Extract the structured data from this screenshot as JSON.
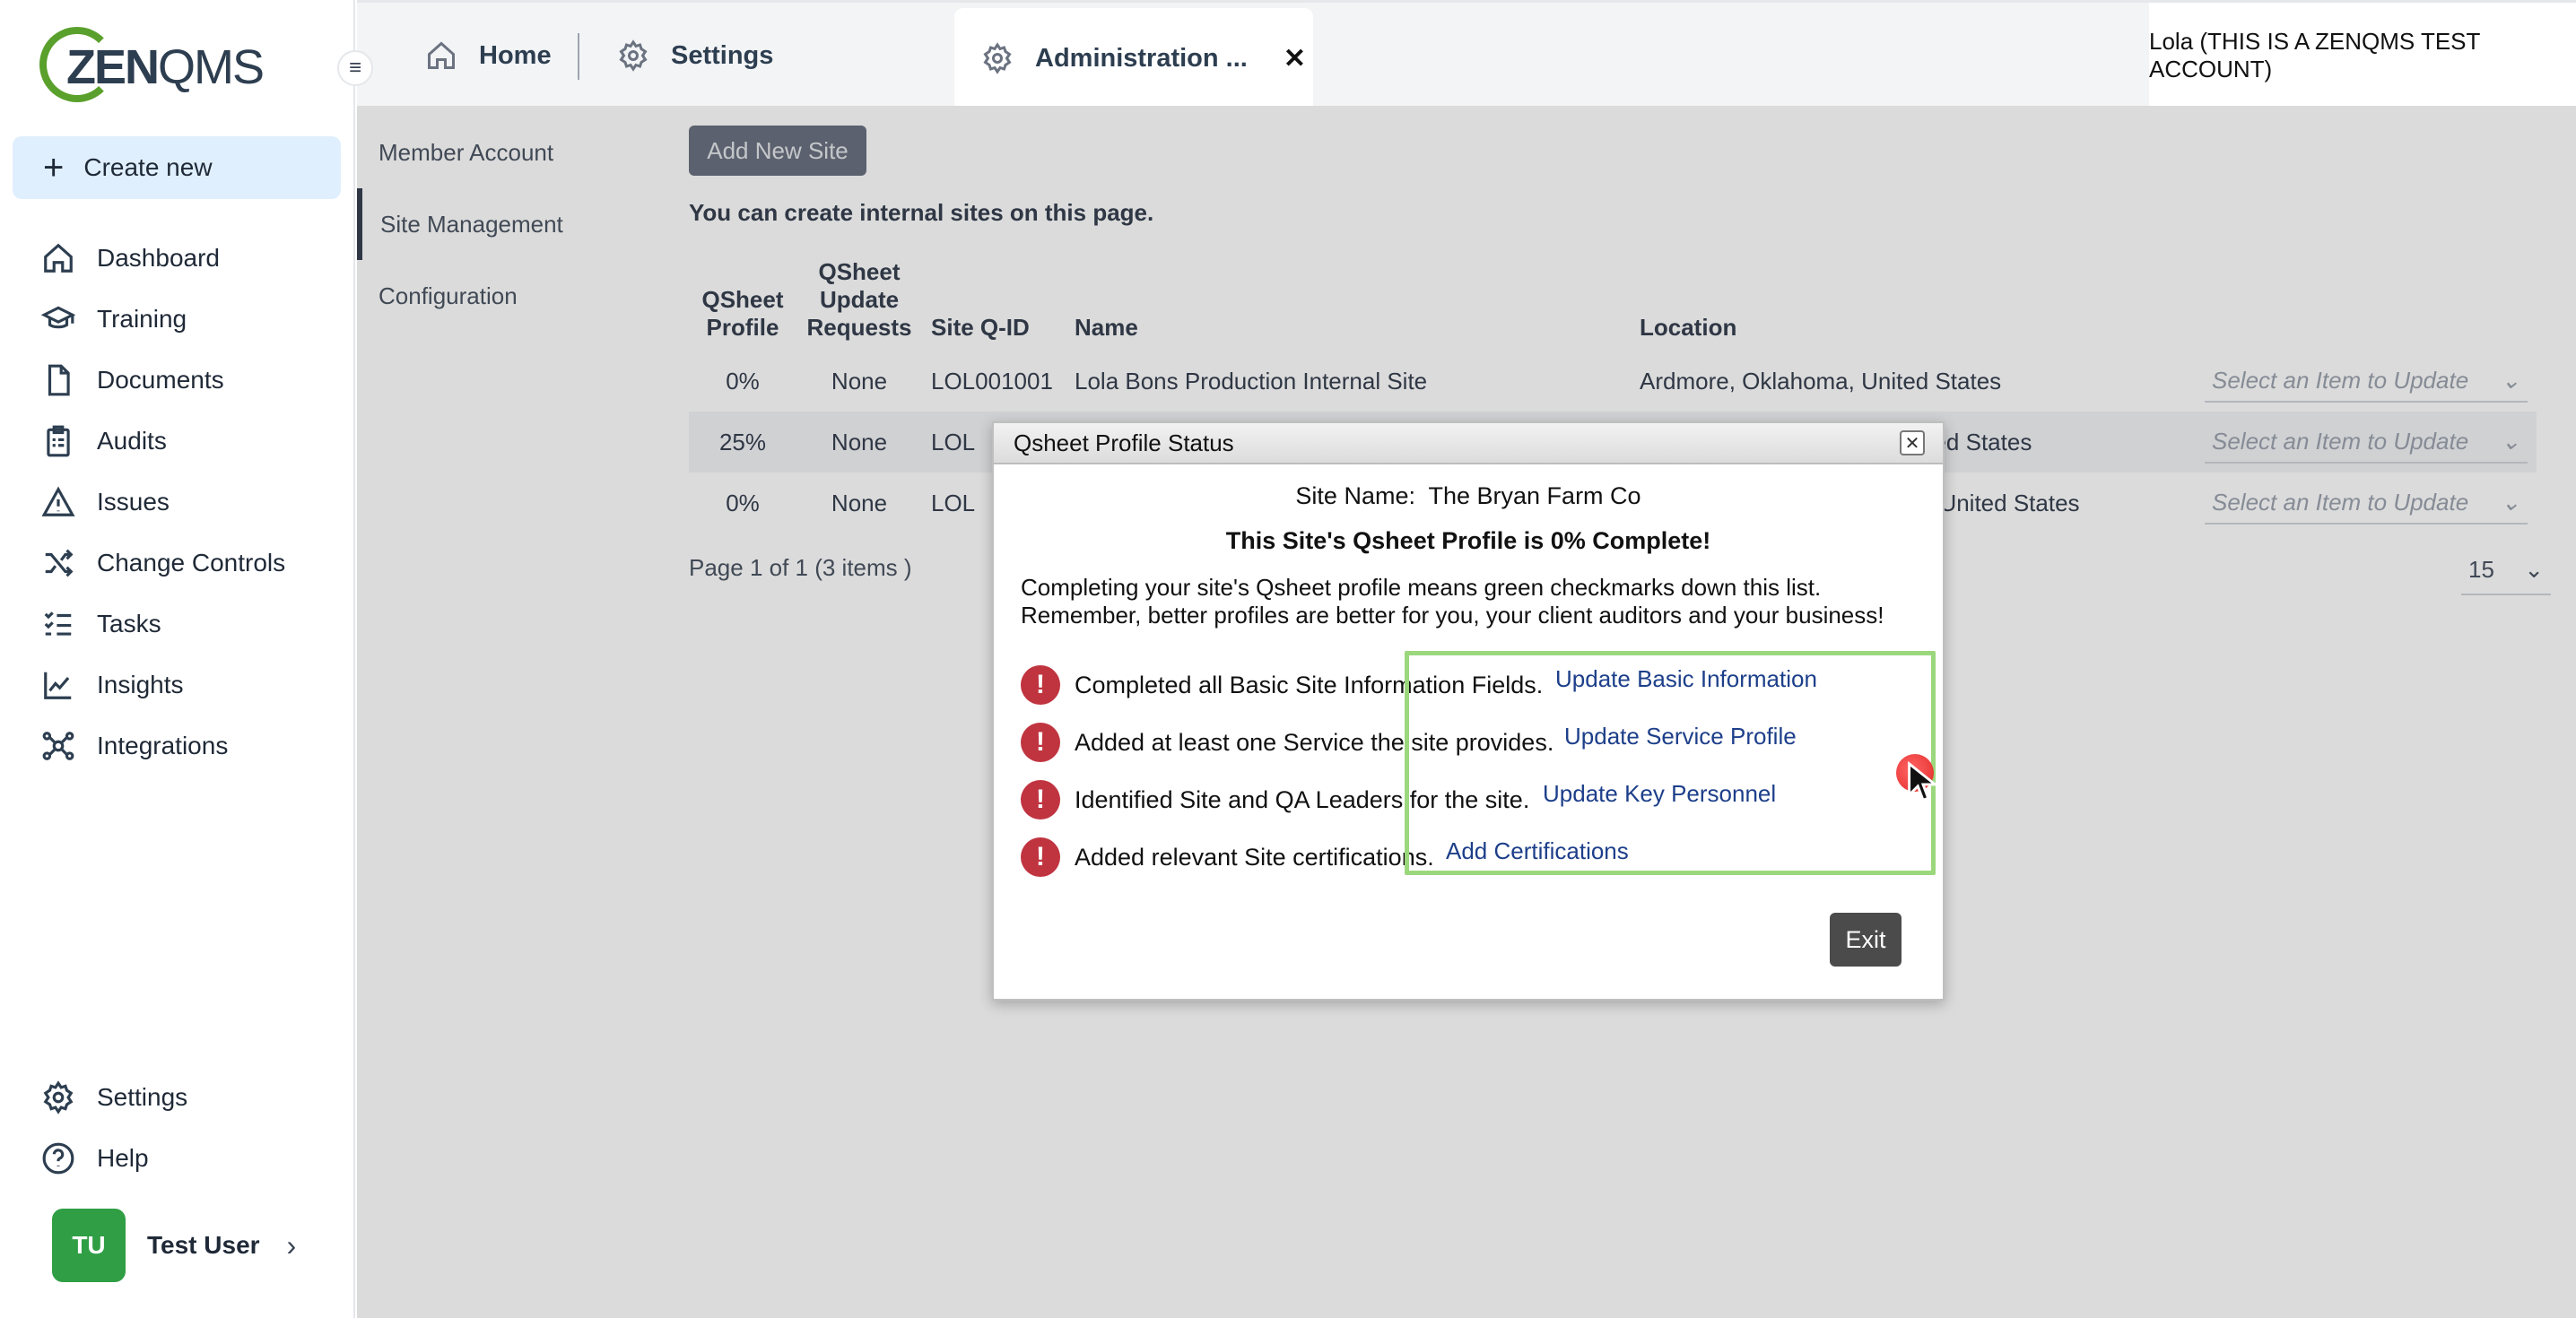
{
  "app": {
    "logo_bold": "ZEN",
    "logo_regular": "QMS",
    "create_new_label": "Create new"
  },
  "sidebar": {
    "items": [
      {
        "label": "Dashboard",
        "icon": "home-icon"
      },
      {
        "label": "Training",
        "icon": "graduation-cap-icon"
      },
      {
        "label": "Documents",
        "icon": "document-icon"
      },
      {
        "label": "Audits",
        "icon": "clipboard-icon"
      },
      {
        "label": "Issues",
        "icon": "warning-icon"
      },
      {
        "label": "Change Controls",
        "icon": "shuffle-icon"
      },
      {
        "label": "Tasks",
        "icon": "checklist-icon"
      },
      {
        "label": "Insights",
        "icon": "chart-icon"
      },
      {
        "label": "Integrations",
        "icon": "network-icon"
      }
    ],
    "bottom_items": [
      {
        "label": "Settings",
        "icon": "gear-icon"
      },
      {
        "label": "Help",
        "icon": "help-icon"
      }
    ],
    "user": {
      "initials": "TU",
      "name": "Test User"
    }
  },
  "topbar": {
    "tabs": [
      {
        "label": "Home"
      },
      {
        "label": "Settings"
      },
      {
        "label": "Administration ..."
      }
    ],
    "account": "Lola (THIS IS A ZENQMS TEST ACCOUNT)"
  },
  "subnav": {
    "items": [
      "Member Account",
      "Site Management",
      "Configuration"
    ]
  },
  "content": {
    "add_button": "Add New Site",
    "intro": "You can create internal sites on this page.",
    "table": {
      "headers": {
        "qsheet_profile": [
          "QSheet",
          "Profile"
        ],
        "qsheet_update": [
          "QSheet",
          "Update",
          "Requests"
        ],
        "site_qid": "Site Q-ID",
        "name": "Name",
        "location": "Location"
      },
      "rows": [
        {
          "profile": "0%",
          "requests": "None",
          "qid": "LOL001001",
          "name": "Lola Bons Production Internal Site",
          "location": "Ardmore, Oklahoma, United States",
          "action": "Select an Item to Update"
        },
        {
          "profile": "25%",
          "requests": "None",
          "qid": "LOL",
          "name": "",
          "location": "nited States",
          "action": "Select an Item to Update"
        },
        {
          "profile": "0%",
          "requests": "None",
          "qid": "LOL",
          "name": "",
          "location": ", United States",
          "action": "Select an Item to Update"
        }
      ]
    },
    "pager": "Page 1 of 1 (3 items )",
    "page_size": "15"
  },
  "modal": {
    "title": "Qsheet Profile Status",
    "site_name_label": "Site Name:",
    "site_name": "The Bryan Farm Co",
    "status": "This Site's Qsheet Profile is  0% Complete!",
    "desc_line1": "Completing your site's Qsheet profile means green checkmarks down this list.",
    "desc_line2": "Remember, better profiles are better for you, your client auditors and your business!",
    "items": [
      {
        "text": "Completed all Basic Site Information Fields.",
        "link": "Update Basic Information"
      },
      {
        "text": "Added at least one Service the site provides.",
        "link": "Update Service Profile"
      },
      {
        "text": "Identified Site and QA Leaders for the site.",
        "link": "Update Key Personnel"
      },
      {
        "text": "Added relevant Site certifications.",
        "link": "Add Certifications"
      }
    ],
    "exit_label": "Exit"
  },
  "colors": {
    "accent_green": "#5aa02c",
    "highlight_green": "#9bd77d",
    "warn_red": "#c0343f",
    "link_blue": "#2563eb"
  }
}
